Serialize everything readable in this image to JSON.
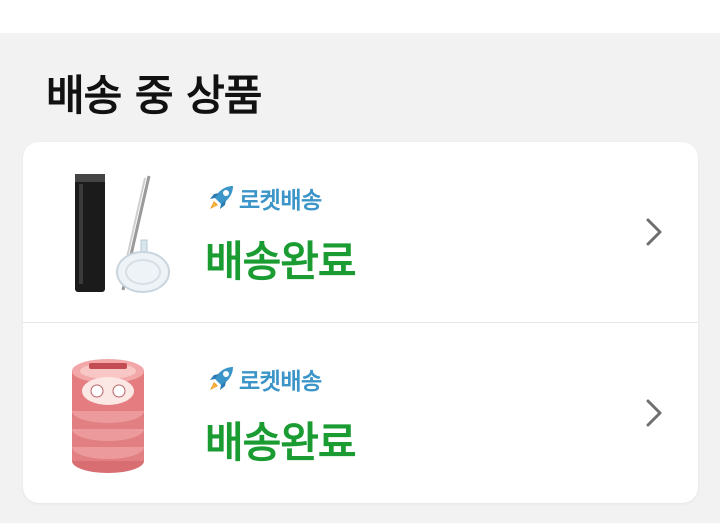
{
  "section": {
    "title": "배송 중 상품"
  },
  "theme": {
    "status_color": "#1a9c32",
    "badge_color": "#3b95c9"
  },
  "items": [
    {
      "badge": "로켓배송",
      "badge_icon": "rocket-icon",
      "status": "배송완료",
      "thumbnail": "tumbler-product-image"
    },
    {
      "badge": "로켓배송",
      "badge_icon": "rocket-icon",
      "status": "배송완료",
      "thumbnail": "tin-cans-product-image"
    }
  ]
}
